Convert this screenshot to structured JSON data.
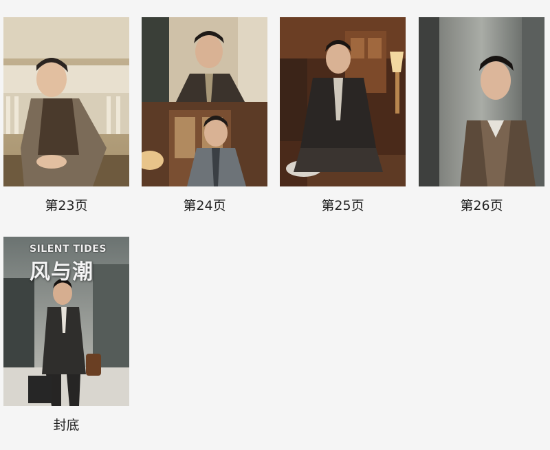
{
  "pages": [
    {
      "caption": "第23页",
      "icon": "photo-thumbnail"
    },
    {
      "caption": "第24页",
      "icon": "photo-thumbnail"
    },
    {
      "caption": "第25页",
      "icon": "photo-thumbnail"
    },
    {
      "caption": "第26页",
      "icon": "photo-thumbnail"
    },
    {
      "caption": "封底",
      "icon": "poster-thumbnail"
    }
  ],
  "poster": {
    "title_en": "SILENT TIDES",
    "title_cn": "风与潮"
  },
  "colors": {
    "background": "#f5f5f5",
    "caption_text": "#222222"
  }
}
